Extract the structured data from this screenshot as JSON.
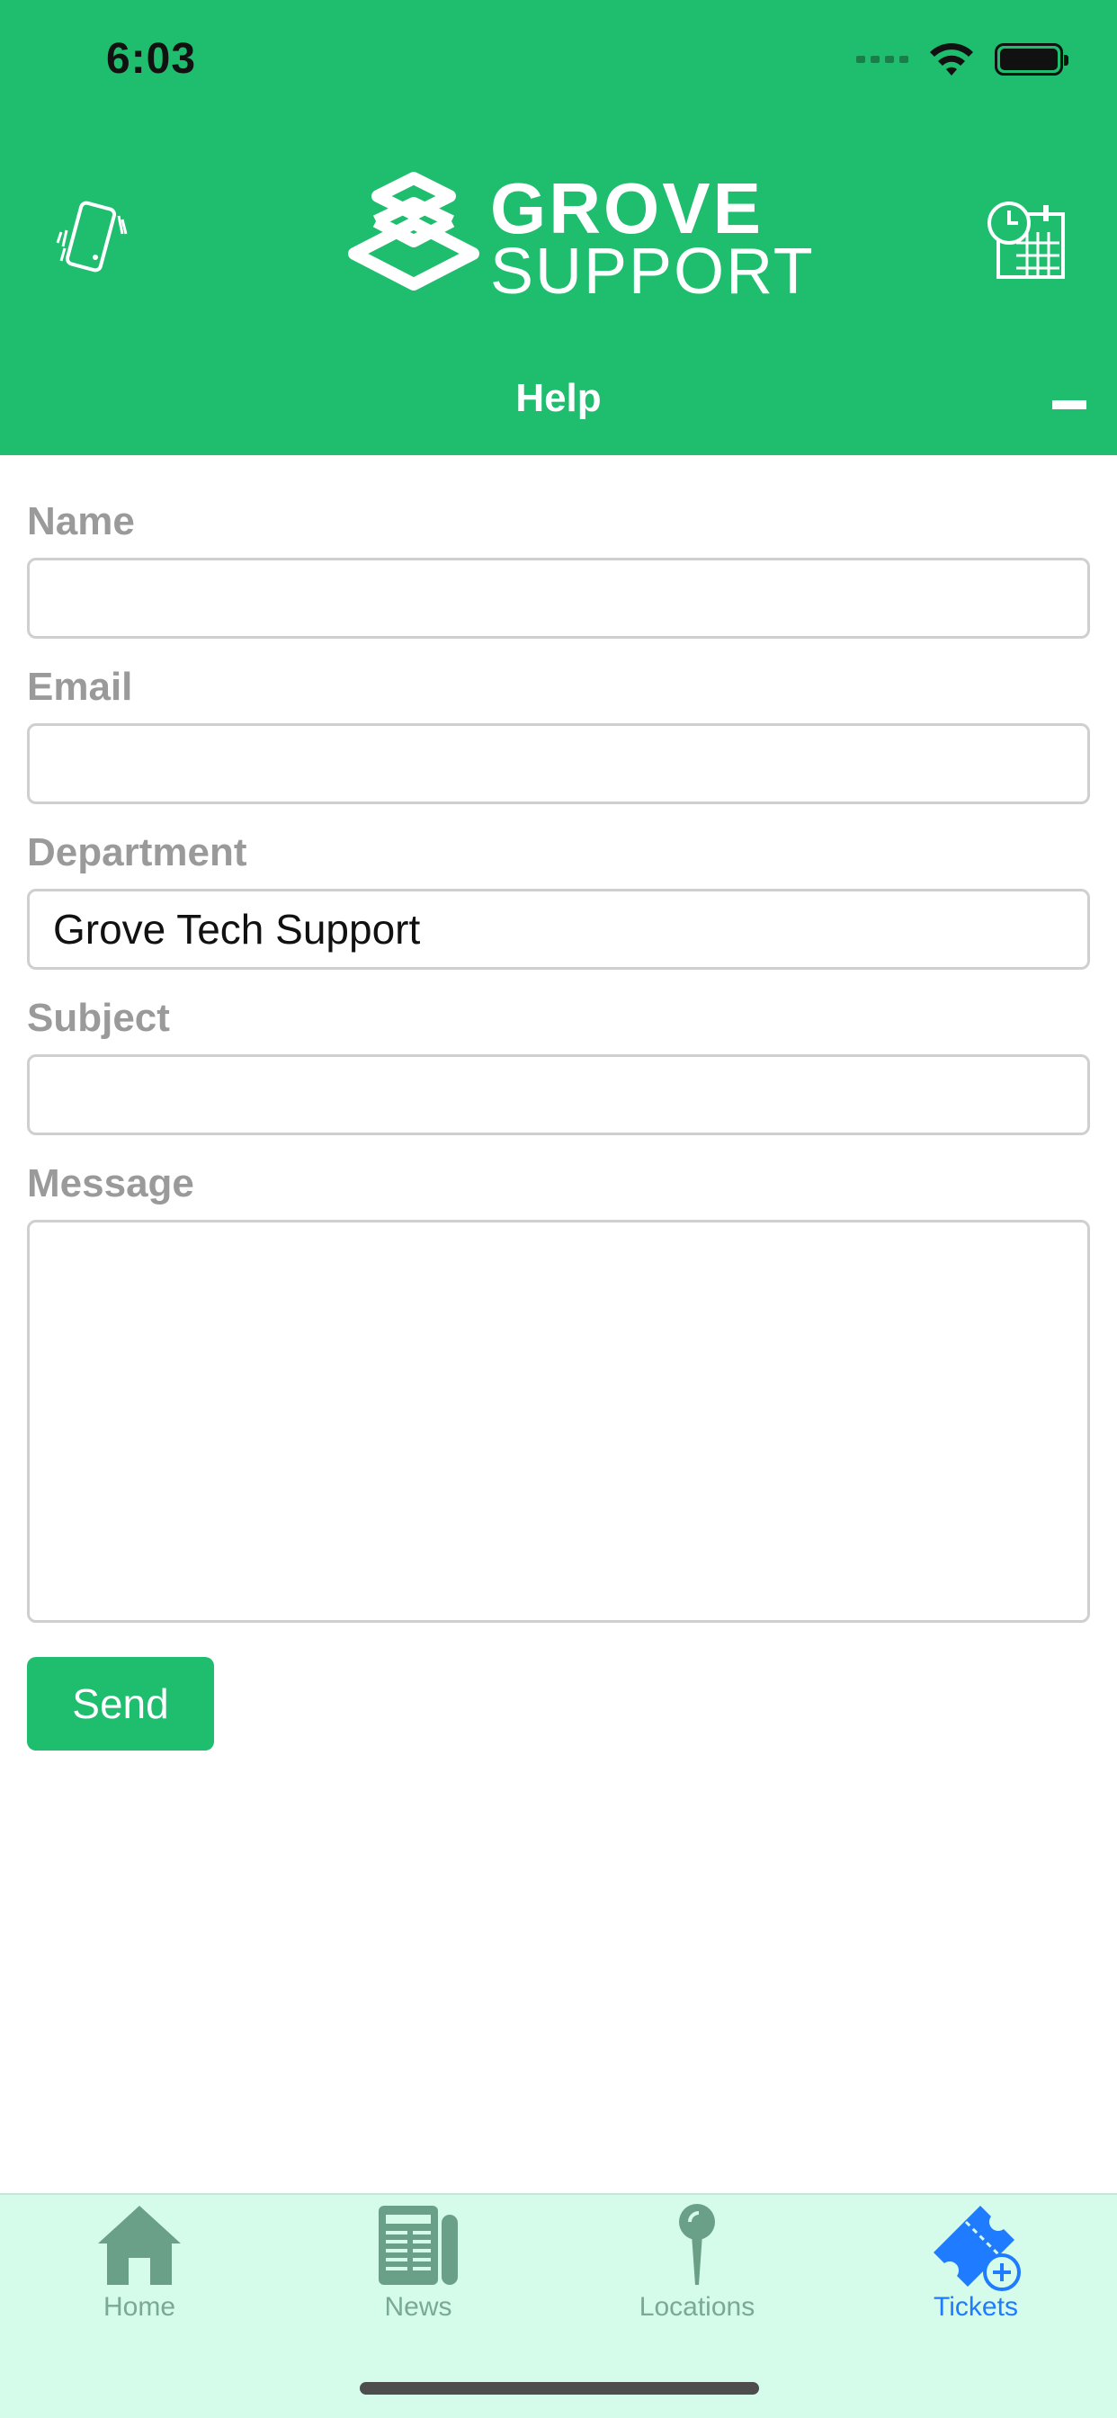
{
  "status_bar": {
    "time": "6:03"
  },
  "header": {
    "logo_line1": "GROVE",
    "logo_line2": "SUPPORT",
    "title": "Help",
    "brand_color": "#1fbd6e"
  },
  "form": {
    "name": {
      "label": "Name",
      "value": ""
    },
    "email": {
      "label": "Email",
      "value": ""
    },
    "department": {
      "label": "Department",
      "value": "Grove Tech Support"
    },
    "subject": {
      "label": "Subject",
      "value": ""
    },
    "message": {
      "label": "Message",
      "value": ""
    },
    "send_label": "Send"
  },
  "tabs": [
    {
      "label": "Home",
      "icon": "home-icon",
      "active": false
    },
    {
      "label": "News",
      "icon": "newspaper-icon",
      "active": false
    },
    {
      "label": "Locations",
      "icon": "map-pin-icon",
      "active": false
    },
    {
      "label": "Tickets",
      "icon": "ticket-add-icon",
      "active": true
    }
  ],
  "colors": {
    "tab_inactive": "#7aa996",
    "tab_active": "#1f7bff",
    "tabbar_bg": "#d5fbea"
  }
}
